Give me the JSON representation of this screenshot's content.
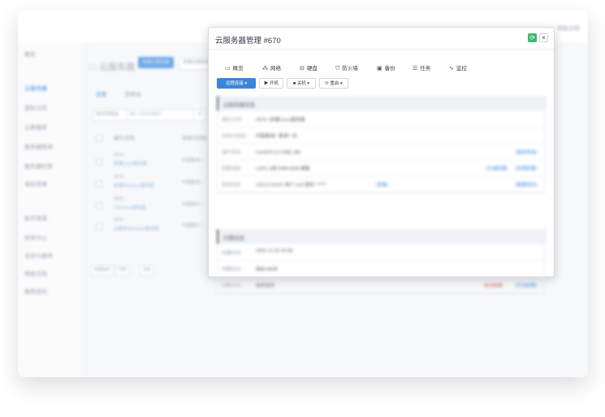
{
  "app": {
    "title": "云服务器",
    "top_help": "帮助文档",
    "create_button": "新建云服务器",
    "secondary_button": "新建云服务器",
    "tabs": [
      "全部",
      "回收站"
    ],
    "filter_select": "按名称筛选",
    "filter_placeholder": "输入名称关键词",
    "column_headers": [
      "编号/名称",
      "地域/可用区"
    ],
    "rows": [
      {
        "id": "#672",
        "name": "新建Linux服务器 ",
        "region": "中国香港 / "
      },
      {
        "id": "#673",
        "name": "新建Windows服务器 ",
        "region": "中国香港 / "
      },
      {
        "id": "#666",
        "name": "CN-Linux服务器 ",
        "region": "中国国内 / "
      },
      {
        "id": "#667",
        "name": "云服务Windows服务器 ",
        "region": "中国国内 / "
      }
    ],
    "bottom_buttons": [
      "批量操作",
      "开机",
      "关机"
    ]
  },
  "sidebar": {
    "items": [
      {
        "label": "概览"
      },
      {
        "label": "云服务器"
      },
      {
        "label": "虚拟主机"
      },
      {
        "label": "云数据库"
      },
      {
        "label": "服务器租用"
      },
      {
        "label": "服务器托管"
      },
      {
        "label": "域名管理"
      },
      {
        "label": "账号管理"
      },
      {
        "label": "财务中心"
      },
      {
        "label": "支持与服务"
      },
      {
        "label": "帮助文档"
      },
      {
        "label": "推荐返利"
      }
    ]
  },
  "modal": {
    "title": "云服务器管理 #670",
    "tabs": [
      {
        "label": "概览",
        "icon": "monitor-icon"
      },
      {
        "label": "网络",
        "icon": "network-icon"
      },
      {
        "label": "硬盘",
        "icon": "disk-icon"
      },
      {
        "label": "防火墙",
        "icon": "shield-icon"
      },
      {
        "label": "备份",
        "icon": "backup-icon"
      },
      {
        "label": "任务",
        "icon": "tasks-icon"
      },
      {
        "label": "监控",
        "icon": "monitor-pulse-icon"
      }
    ],
    "actions": {
      "remote": "远程连接 ▾",
      "power_on": "▶ 开机",
      "power_off": "■ 关机 ▾",
      "restart": "⟳ 重启 ▾"
    },
    "section_basic": {
      "title": "云服务器信息",
      "rows": [
        {
          "label": "编号/名称",
          "value": "#670 / 新建Linux服务器"
        },
        {
          "label": "地域/可用区",
          "value": "中国香港 / 香港一区"
        },
        {
          "label": "操作系统",
          "value": "CentOS 8.2 64位 x86",
          "link": "[重装系统]"
        },
        {
          "label": "配置规格",
          "value": "vCPU 4核   RAM 8GB   硬盘",
          "link": "[升级配置]",
          "link2": "[变更配置]"
        },
        {
          "label": "登录信息",
          "value": "103.21.55.87   用户   root   密码   ******",
          "link": "[查看]",
          "link2": "[重置密码]"
        }
      ]
    },
    "section_billing": {
      "title": "付费信息",
      "rows": [
        {
          "label": "创建时间",
          "value": "2023-11-02 20:48"
        },
        {
          "label": "到期时间",
          "value": "剩余180天"
        },
        {
          "label": "付费方式",
          "value": "包年包月",
          "red": "自动续费",
          "link": "[手动续费]"
        }
      ]
    }
  }
}
